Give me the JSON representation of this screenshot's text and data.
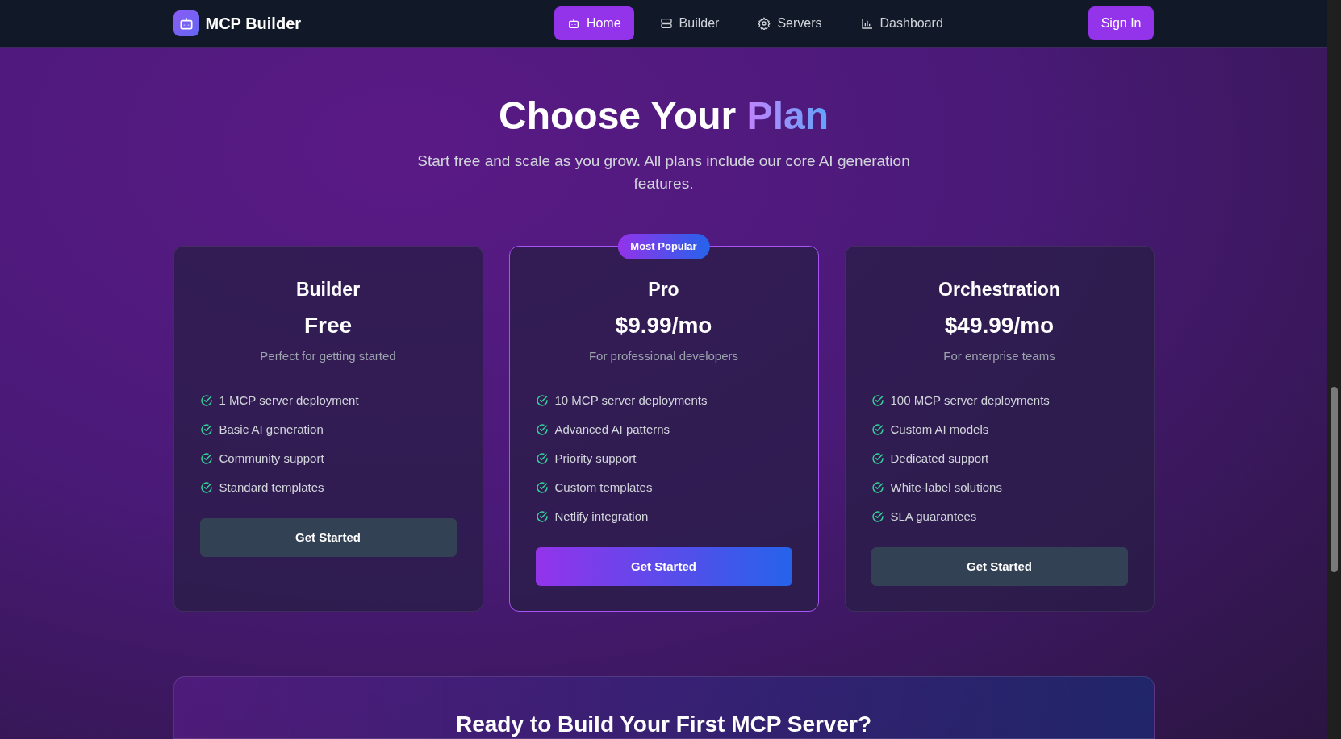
{
  "navbar": {
    "brand": "MCP Builder",
    "links": [
      {
        "label": "Home",
        "selected": true
      },
      {
        "label": "Builder",
        "selected": false
      },
      {
        "label": "Servers",
        "selected": false
      },
      {
        "label": "Dashboard",
        "selected": false
      }
    ],
    "sign_in": "Sign In"
  },
  "hero": {
    "title": "Choose Your",
    "title_accent": "Plan",
    "subtitle": "Start free and scale as you grow. All plans include our core AI generation features."
  },
  "plans": [
    {
      "name": "Builder",
      "price": "Free",
      "description": "Perfect for getting started",
      "popular": false,
      "features": [
        "1 MCP server deployment",
        "Basic AI generation",
        "Community support",
        "Standard templates"
      ],
      "button": "Get Started"
    },
    {
      "name": "Pro",
      "price": "$9.99/mo",
      "description": "For professional developers",
      "popular": true,
      "badge": "Most Popular",
      "features": [
        "10 MCP server deployments",
        "Advanced AI patterns",
        "Priority support",
        "Custom templates",
        "Netlify integration"
      ],
      "button": "Get Started"
    },
    {
      "name": "Orchestration",
      "price": "$49.99/mo",
      "description": "For enterprise teams",
      "popular": false,
      "features": [
        "100 MCP server deployments",
        "Custom AI models",
        "Dedicated support",
        "White-label solutions",
        "SLA guarantees"
      ],
      "button": "Get Started"
    }
  ],
  "cta": {
    "title": "Ready to Build Your First MCP Server?"
  }
}
